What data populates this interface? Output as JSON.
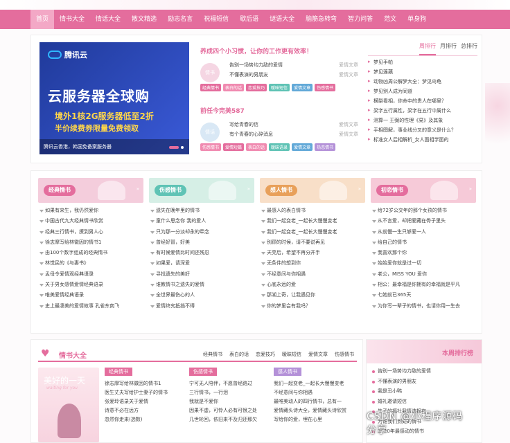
{
  "nav": [
    "首页",
    "情书大全",
    "情话大全",
    "散文精选",
    "励志名言",
    "祝福短信",
    "歇后语",
    "谜语大全",
    "脑筋急转弯",
    "智力问答",
    "范文",
    "单身狗"
  ],
  "banner": {
    "brand": "腾讯云",
    "headline": "云服务器全球购",
    "line1": "境外1核2G服务器低至2折",
    "line2": "半价续费券限量免费领取",
    "caption": "腾讯云香港，韩国免备案服务器"
  },
  "articles": [
    {
      "title": "养成四个小习惯，让你的工作更有效率！",
      "avatar": "情书",
      "lines": [
        [
          "告别一场势均力敌的爱情",
          "爱情文章"
        ],
        [
          "不懂表演的男朋友",
          "爱情文章"
        ]
      ],
      "tags": [
        [
          "经典情书",
          "#e46d9d"
        ],
        [
          "表白的话",
          "#f08ab0"
        ],
        [
          "恋爱技巧",
          "#e46d9d"
        ],
        [
          "暧昧短信",
          "#5fc3b5"
        ],
        [
          "爱情文章",
          "#62a9d8"
        ],
        [
          "伤感情书",
          "#e46d9d"
        ]
      ]
    },
    {
      "title": "前任今完美587",
      "avatar": "情话",
      "lines": [
        [
          "写给青春的信",
          "爱情文章"
        ],
        [
          "有个青春的心碎消息",
          "爱情文章"
        ]
      ],
      "tags": [
        [
          "伤感情书",
          "#f08ab0"
        ],
        [
          "爱情短篇",
          "#e46d9d"
        ],
        [
          "表白的话",
          "#f08ab0"
        ],
        [
          "暧昧语录",
          "#5fc3b5"
        ],
        [
          "爱情文章",
          "#62a9d8"
        ],
        [
          "热恋情书",
          "#b491d8"
        ]
      ]
    }
  ],
  "rank": {
    "tabs": [
      "周排行",
      "月排行",
      "总排行"
    ],
    "items": [
      "梦见手帕",
      "梦见莲藕",
      "动物凶周公解梦大全：梦见鸟龟",
      "梦见别人成为同道",
      "横梨看相，你命中的贵人在哪里？",
      "梁字五行属性，梁字在五行中属什么",
      "测算一 王弼的性理《易》及其象",
      "手相图解，事业线分叉的意义是什么？",
      "标准女人后相解析_女人面相学面的"
    ]
  },
  "columns": [
    {
      "label": "经典情书",
      "color": "#e46d9d",
      "bg": "#f4cddc",
      "items": [
        "如果有来生，我仍然爱你",
        "中国古代九大经典情书欣赏",
        "经典三行情书，撩到男人心",
        "徐志摩写给林徽因的情书1",
        "由100个数字组成的经典情书",
        "林觉民的《与妻书》",
        "孟母令爱情观经典语录",
        "关于男女感情爱情经典语录",
        "唯美爱情经典语录",
        "史上最凄美的爱情故事 孔雀东南飞"
      ]
    },
    {
      "label": "伤感情书",
      "color": "#5fc3b5",
      "bg": "#d6efe6",
      "items": [
        "遗失在晚年里的情书",
        "童什么思念你 我的爱人",
        "只为那一分淡却永的牵念",
        "曾经好冒，好美",
        "有时候爱情比时间还残忍",
        "如果爱，请深爱",
        "寻找遗失的美好",
        "谁教情书之遗失的爱情",
        "全世界最伤心的人",
        "爱情终究抵挡不得"
      ]
    },
    {
      "label": "感人情书",
      "color": "#e8a05a",
      "bg": "#f8dfc8",
      "items": [
        "最感人的表白情书",
        "我们一起变老_一起长大慢慢变老",
        "我们一起变老_一起长大慢慢变老",
        "别顾的时候，请不要说再见",
        "天亮后，希望不再分开手",
        "无条件的想到你",
        "不经意间与你相遇",
        "心底永远的爱",
        "那湖上奇，让我遇见你",
        "你的梦里会有我吗？"
      ]
    },
    {
      "label": "初恋情书",
      "color": "#e46d9d",
      "bg": "#f6cad8",
      "items": [
        "给72岁公交年的那个女孩的情书",
        "从不言爱，却把爱藏在骨子里头",
        "从前慢一生只够爱一人",
        "给自己的情书",
        "我喜欢那个你",
        "始始爱你就是过一切",
        "老公，MISS YOU 爱你",
        "相公：最幸福是你拥有的幸福就是平凡",
        "七她前已365天",
        "为你写一辈子的情书，也请你用一生去"
      ]
    }
  ],
  "section3": {
    "title": "情书大全",
    "cats": [
      "经典情书",
      "表白的话",
      "恋爱技巧",
      "暧昧短信",
      "爱情文章",
      "伤感情书"
    ],
    "pic": {
      "title": "美好的一天",
      "sub": "waiting for you"
    },
    "lists": [
      {
        "label": "经典情书",
        "color": "#e46d9d",
        "items": [
          "徐志摩写给林徽因的情书1",
          "医生丈夫写给护士妻子的情书",
          "张爱玲语录关于爱情",
          "诗意不必在远方",
          "忽然你走来(选数)"
        ]
      },
      {
        "label": "伤感情书",
        "color": "#e46d9d",
        "items": [
          "宁可无人陪伴，不愿曾经路过",
          "三行情书，一行泪",
          "我就是不爱你",
          "因果不虚，可怜人必有可恨之处",
          "几世轮回，依旧来不及归还那欠"
        ]
      },
      {
        "label": "感人情书",
        "color": "#b491d8",
        "items": [
          "我们一起变老_一起长大慢慢变老",
          "不经意间与你相遇",
          "最唯美动人的四行情书，总有一",
          "爱情藏头诗大全，爱情藏头诗欣赏",
          "写给你的爱，埋在心里"
        ]
      }
    ]
  },
  "weekly": {
    "title": "本周排行榜",
    "items": [
      "告别一场势均力敌的爱情",
      "不懂表演的男朋友",
      "我是丑小鸭",
      "婚礼邀请短信",
      "生子的福社我情选报存",
      "为谁我们到处的情书",
      "2020年最感动的情书"
    ]
  },
  "watermark": "CSDN @小程序源码分享"
}
